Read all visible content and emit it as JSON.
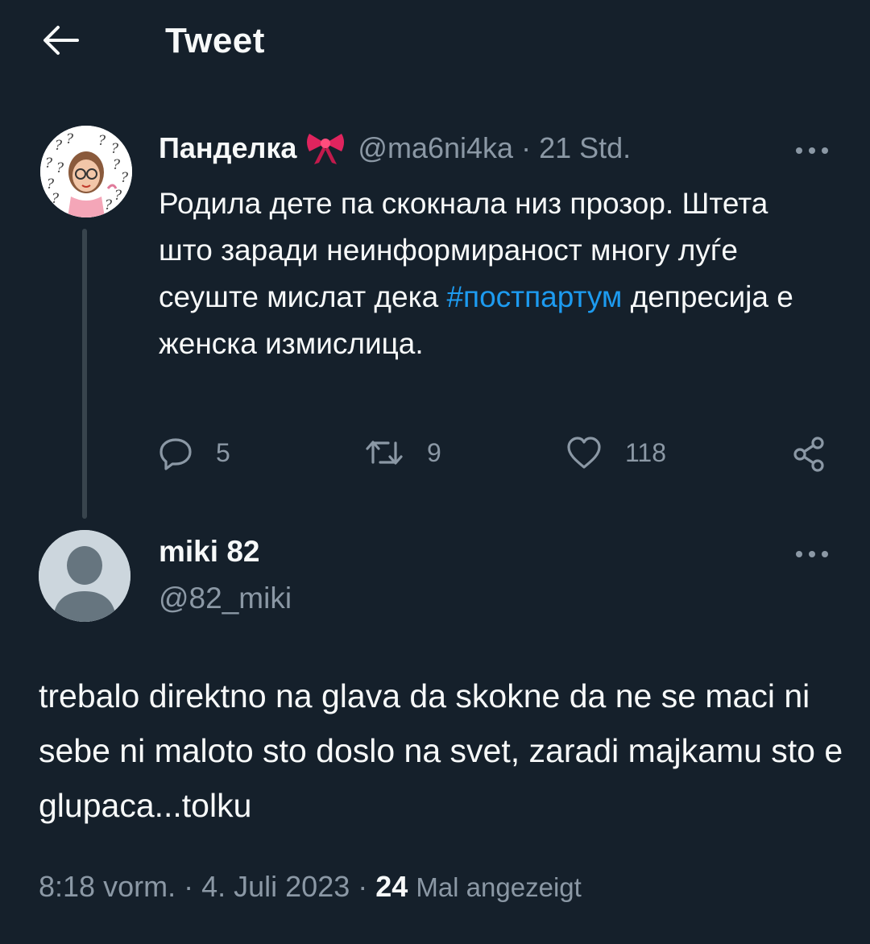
{
  "header": {
    "title": "Tweet"
  },
  "parent_tweet": {
    "display_name": "Панделка",
    "name_emoji_icon": "ribbon-bow-icon",
    "handle": "@ma6ni4ka",
    "separator": "·",
    "time": "21 Std.",
    "text_part1": "Родила дете па скокнала низ прозор. Штета што заради неинформираност многу луѓе сеуште мислат дека ",
    "hashtag": "#постпартум",
    "text_part2": " депресија е женска измислица.",
    "actions": {
      "replies": "5",
      "retweets": "9",
      "likes": "118"
    },
    "colors": {
      "hashtag": "#1d9bf0"
    }
  },
  "main_tweet": {
    "display_name": "miki 82",
    "handle": "@82_miki",
    "text": "trebalo direktno na glava da skokne da ne se maci ni sebe ni maloto sto doslo na svet, zaradi majkamu sto e glupaca...tolku",
    "time": "8:18 vorm.",
    "separator": "·",
    "date": "4. Juli 2023",
    "views_count": "24",
    "views_label": "Mal angezeigt"
  },
  "colors": {
    "background": "#15202b",
    "text_primary": "#f7f9f9",
    "text_secondary": "#8b98a5",
    "thread_line": "#38444d"
  }
}
